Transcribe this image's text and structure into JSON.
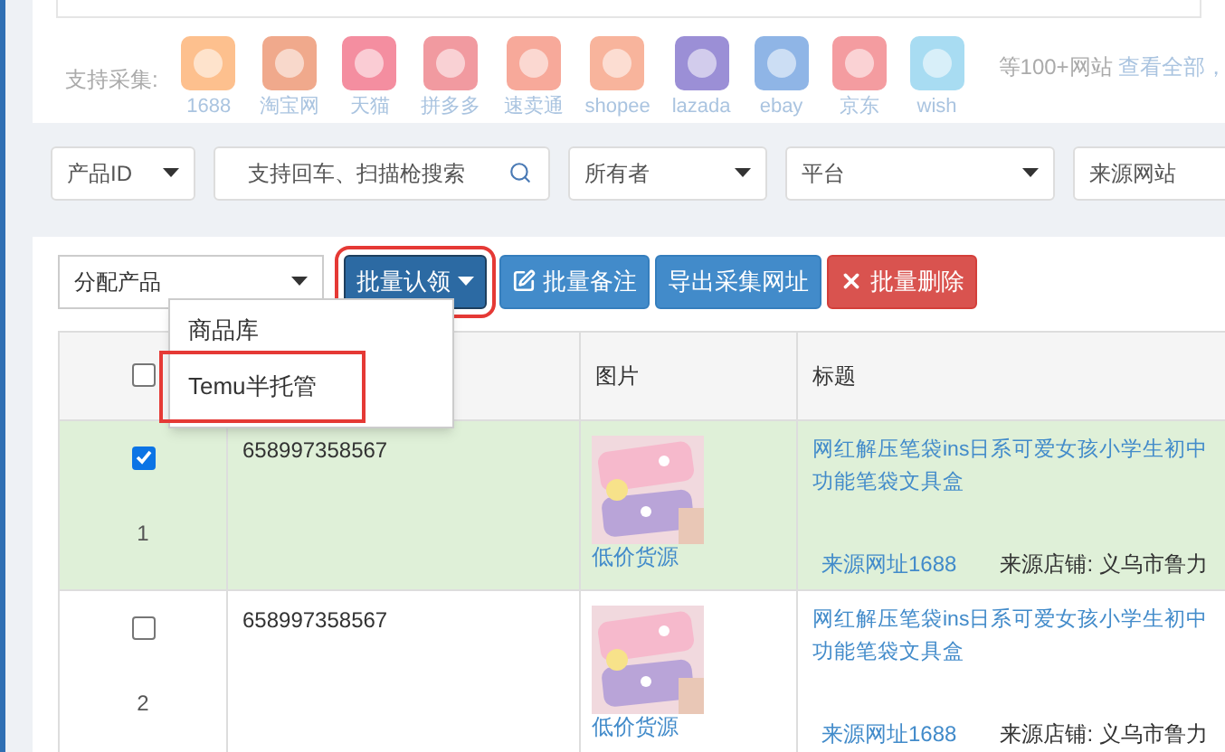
{
  "collect": {
    "label": "支持采集:",
    "platforms": [
      {
        "name": "1688",
        "color": "#fdc08e"
      },
      {
        "name": "淘宝网",
        "color": "#f0a98c"
      },
      {
        "name": "天猫",
        "color": "#f48ea0"
      },
      {
        "name": "拼多多",
        "color": "#f19aa0"
      },
      {
        "name": "速卖通",
        "color": "#f7a99a"
      },
      {
        "name": "shopee",
        "color": "#f8b49c"
      },
      {
        "name": "lazada",
        "color": "#9b8fd6"
      },
      {
        "name": "ebay",
        "color": "#8fb5e6"
      },
      {
        "name": "京东",
        "color": "#f49ca0"
      },
      {
        "name": "wish",
        "color": "#a8dcf2"
      }
    ],
    "more": "等100+网站",
    "view_all": "查看全部，"
  },
  "filters": [
    {
      "kind": "select",
      "value": "产品ID"
    },
    {
      "kind": "search",
      "placeholder": "支持回车、扫描枪搜索"
    },
    {
      "kind": "select",
      "value": "所有者"
    },
    {
      "kind": "select",
      "value": "平台"
    },
    {
      "kind": "select",
      "value": "来源网站"
    }
  ],
  "toolbar": {
    "assign": "分配产品",
    "buttons": [
      {
        "kind": "dropdown",
        "label": "批量认领",
        "highlighted": true
      },
      {
        "kind": "edit",
        "label": "批量备注",
        "highlighted": false
      },
      {
        "kind": "plain",
        "label": "导出采集网址",
        "highlighted": false
      },
      {
        "kind": "delete",
        "label": "批量删除",
        "highlighted": false
      }
    ]
  },
  "menu": {
    "items": [
      {
        "label": "商品库",
        "highlighted": false
      },
      {
        "label": "Temu半托管",
        "highlighted": true
      }
    ]
  },
  "table": {
    "header_checked": false,
    "columns": [
      "图片",
      "标题"
    ],
    "rows": [
      {
        "selected": true,
        "checked": true,
        "index": "1",
        "id": "658997358567",
        "picture_link": "低价货源",
        "title_lines": [
          "网红解压笔袋ins日系可爱女孩小学生初中",
          "功能笔袋文具盒"
        ],
        "source_link": "来源网址1688",
        "shop": "来源店铺: 义乌市鲁力"
      },
      {
        "selected": false,
        "checked": false,
        "index": "2",
        "id": "658997358567",
        "picture_link": "低价货源",
        "title_lines": [
          "网红解压笔袋ins日系可爱女孩小学生初中",
          "功能笔袋文具盒"
        ],
        "source_link": "来源网址1688",
        "shop": "来源店铺: 义乌市鲁力"
      }
    ]
  }
}
